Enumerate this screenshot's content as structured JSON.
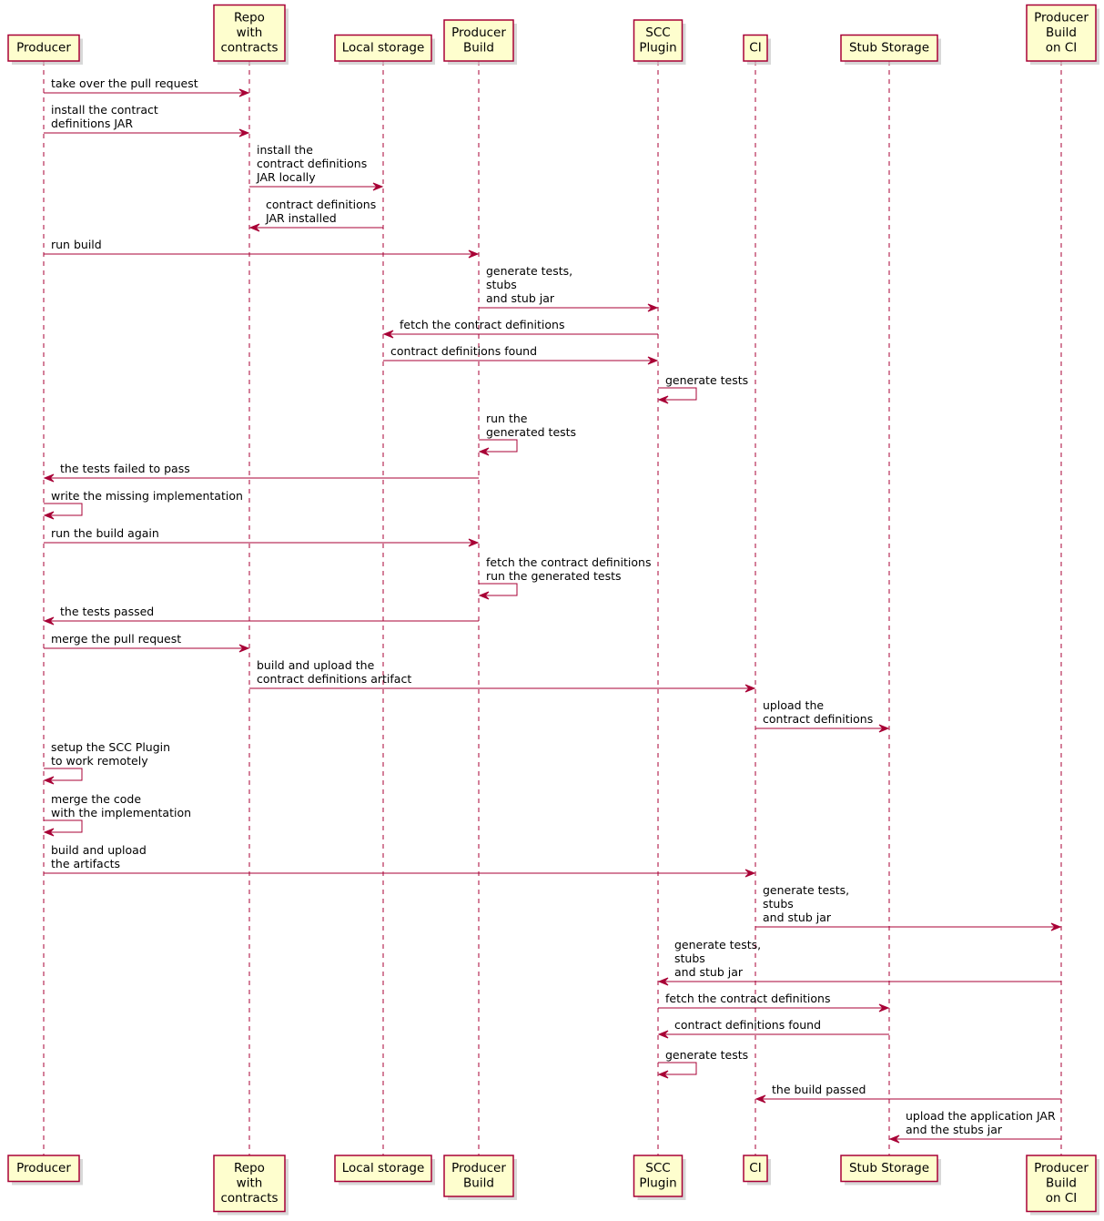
{
  "diagram": {
    "type": "sequence",
    "colors": {
      "participant_fill": "#FEFECE",
      "participant_border": "#A80036",
      "line": "#A80036",
      "background": "#FFFFFF"
    },
    "participants": [
      {
        "id": "producer",
        "lines": [
          "Producer"
        ]
      },
      {
        "id": "repo",
        "lines": [
          "Repo",
          "with",
          "contracts"
        ]
      },
      {
        "id": "local",
        "lines": [
          "Local storage"
        ]
      },
      {
        "id": "build",
        "lines": [
          "Producer",
          "Build"
        ]
      },
      {
        "id": "scc",
        "lines": [
          "SCC",
          "Plugin"
        ]
      },
      {
        "id": "ci",
        "lines": [
          "CI"
        ]
      },
      {
        "id": "stub",
        "lines": [
          "Stub Storage"
        ]
      },
      {
        "id": "buildci",
        "lines": [
          "Producer",
          "Build",
          "on CI"
        ]
      }
    ],
    "messages": [
      {
        "from": "producer",
        "to": "repo",
        "lines": [
          "take over the pull request"
        ]
      },
      {
        "from": "producer",
        "to": "repo",
        "lines": [
          "install the contract",
          "definitions JAR"
        ]
      },
      {
        "from": "repo",
        "to": "local",
        "lines": [
          "install the",
          "contract definitions",
          "JAR locally"
        ]
      },
      {
        "from": "local",
        "to": "repo",
        "lines": [
          "contract definitions",
          "JAR installed"
        ]
      },
      {
        "from": "producer",
        "to": "build",
        "lines": [
          "run build"
        ]
      },
      {
        "from": "build",
        "to": "scc",
        "lines": [
          "generate tests,",
          "stubs",
          "and stub jar"
        ]
      },
      {
        "from": "scc",
        "to": "local",
        "lines": [
          "fetch the contract definitions"
        ]
      },
      {
        "from": "local",
        "to": "scc",
        "lines": [
          "contract definitions found"
        ]
      },
      {
        "from": "scc",
        "to": "scc",
        "lines": [
          "generate tests"
        ]
      },
      {
        "from": "build",
        "to": "build",
        "lines": [
          "run the",
          "generated tests"
        ]
      },
      {
        "from": "build",
        "to": "producer",
        "lines": [
          "the tests failed to pass"
        ]
      },
      {
        "from": "producer",
        "to": "producer",
        "lines": [
          "write the missing implementation"
        ]
      },
      {
        "from": "producer",
        "to": "build",
        "lines": [
          "run the build again"
        ]
      },
      {
        "from": "build",
        "to": "build",
        "lines": [
          "fetch the contract definitions",
          "run the generated tests"
        ]
      },
      {
        "from": "build",
        "to": "producer",
        "lines": [
          "the tests passed"
        ]
      },
      {
        "from": "producer",
        "to": "repo",
        "lines": [
          "merge the pull request"
        ]
      },
      {
        "from": "repo",
        "to": "ci",
        "lines": [
          "build and upload the",
          "contract definitions artifact"
        ]
      },
      {
        "from": "ci",
        "to": "stub",
        "lines": [
          "upload the",
          "contract definitions"
        ]
      },
      {
        "from": "producer",
        "to": "producer",
        "lines": [
          "setup the SCC Plugin",
          "to work remotely"
        ]
      },
      {
        "from": "producer",
        "to": "producer",
        "lines": [
          "merge the code",
          "with the implementation"
        ]
      },
      {
        "from": "producer",
        "to": "ci",
        "lines": [
          "build and upload",
          "the artifacts"
        ]
      },
      {
        "from": "ci",
        "to": "buildci",
        "lines": [
          "generate tests,",
          "stubs",
          "and stub jar"
        ]
      },
      {
        "from": "buildci",
        "to": "scc",
        "lines": [
          "generate tests,",
          "stubs",
          "and stub jar"
        ]
      },
      {
        "from": "scc",
        "to": "stub",
        "lines": [
          "fetch the contract definitions"
        ]
      },
      {
        "from": "stub",
        "to": "scc",
        "lines": [
          "contract definitions found"
        ]
      },
      {
        "from": "scc",
        "to": "scc",
        "lines": [
          "generate tests"
        ]
      },
      {
        "from": "buildci",
        "to": "ci",
        "lines": [
          "the build passed"
        ]
      },
      {
        "from": "buildci",
        "to": "stub",
        "lines": [
          "upload the application JAR",
          "and the stubs jar"
        ]
      }
    ]
  }
}
